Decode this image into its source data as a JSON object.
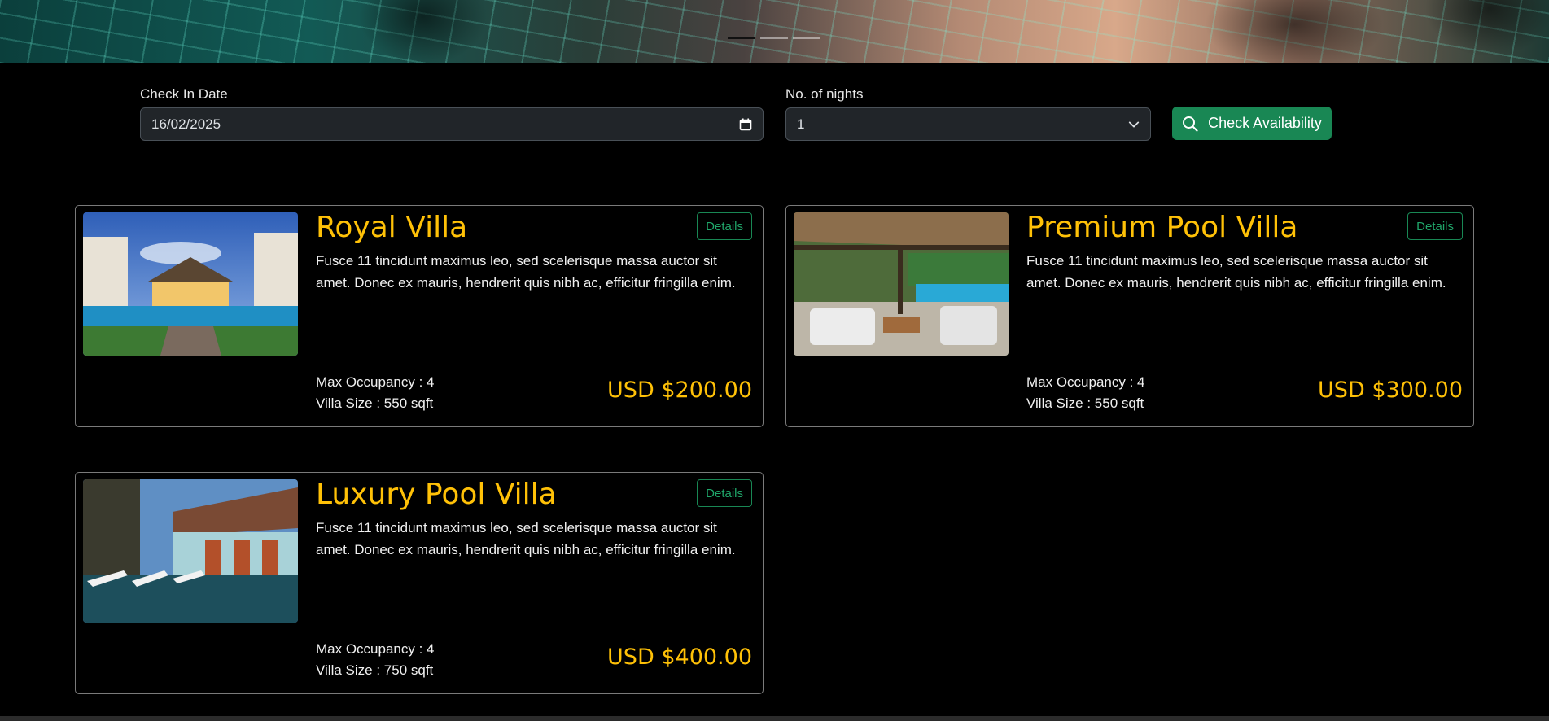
{
  "hero": {
    "carousel_slides": 3,
    "active_slide": 1
  },
  "search": {
    "checkin_label": "Check In Date",
    "checkin_value": "16/02/2025",
    "nights_label": "No. of nights",
    "nights_value": "1",
    "check_button": "Check Availability"
  },
  "villas": [
    {
      "name": "Royal Villa",
      "details_label": "Details",
      "description": "Fusce 11 tincidunt maximus leo, sed scelerisque massa auctor sit amet. Donec ex mauris, hendrerit quis nibh ac, efficitur fringilla enim.",
      "occupancy": "Max Occupancy : 4",
      "size": "Villa Size : 550 sqft",
      "currency": "USD",
      "price": "$200.00"
    },
    {
      "name": "Premium Pool Villa",
      "details_label": "Details",
      "description": "Fusce 11 tincidunt maximus leo, sed scelerisque massa auctor sit amet. Donec ex mauris, hendrerit quis nibh ac, efficitur fringilla enim.",
      "occupancy": "Max Occupancy : 4",
      "size": "Villa Size : 550 sqft",
      "currency": "USD",
      "price": "$300.00"
    },
    {
      "name": "Luxury Pool Villa",
      "details_label": "Details",
      "description": "Fusce 11 tincidunt maximus leo, sed scelerisque massa auctor sit amet. Donec ex mauris, hendrerit quis nibh ac, efficitur fringilla enim.",
      "occupancy": "Max Occupancy : 4",
      "size": "Villa Size : 750 sqft",
      "currency": "USD",
      "price": "$400.00"
    }
  ],
  "colors": {
    "accent_gold": "#ffc107",
    "success_green": "#198754",
    "price_underline": "#fd7e14",
    "input_bg": "#212529"
  },
  "icons": {
    "calendar": "calendar-icon",
    "dropdown": "chevron-down-icon",
    "search": "search-icon"
  }
}
